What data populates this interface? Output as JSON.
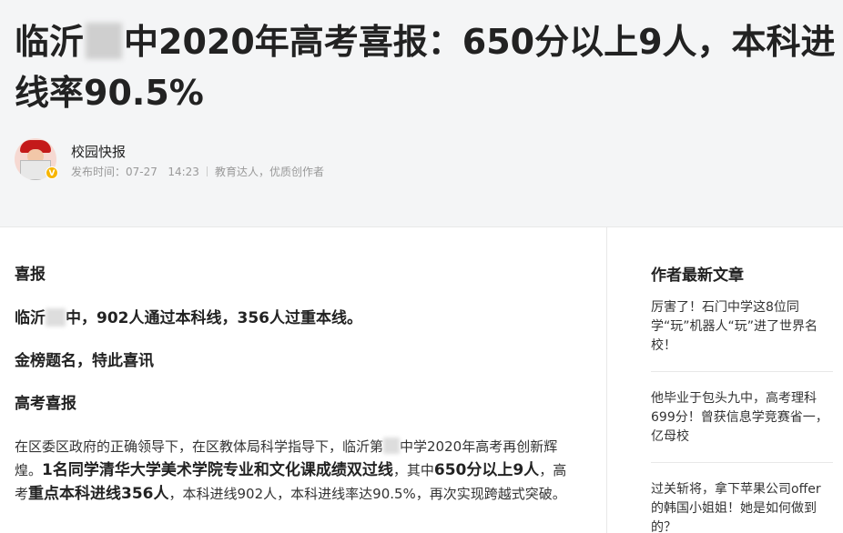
{
  "article": {
    "title_a": "临沂",
    "title_b": "中2020年高考喜报：650分以上9人，本科进线率90.5%"
  },
  "author": {
    "name": "校园快报",
    "publish_label": "发布时间：",
    "date": "07-27",
    "time": "14:23",
    "tags": "教育达人，优质创作者",
    "badge": "V"
  },
  "content": {
    "p1": "喜报",
    "p2_a": "临沂",
    "p2_b": "中，902人通过本科线，356人过重本线。",
    "p3": "金榜题名，特此喜讯",
    "p4": "高考喜报",
    "p5_a": "在区委区政府的正确领导下，在区教体局科学指导下，临沂第",
    "p5_b": "中学2020年高考再创新辉煌。",
    "p5_c": "1名同学清华大学美术学院专业和文化课成绩双过线",
    "p5_d": "，其中",
    "p5_e": "650分以上9人",
    "p5_f": "，高考",
    "p5_g": "重点本科进线356人",
    "p5_h": "，本科进线902人，本科进线率达90.5%，再次实现跨越式突破。"
  },
  "sidebar": {
    "title": "作者最新文章",
    "items": [
      "厉害了！石门中学这8位同学“玩”机器人“玩”进了世界名校！",
      "他毕业于包头九中，高考理科699分！曾获信息学竞赛省一，亿母校",
      "过关斩将，拿下苹果公司offer的韩国小姐姐！她是如何做到的？"
    ]
  }
}
